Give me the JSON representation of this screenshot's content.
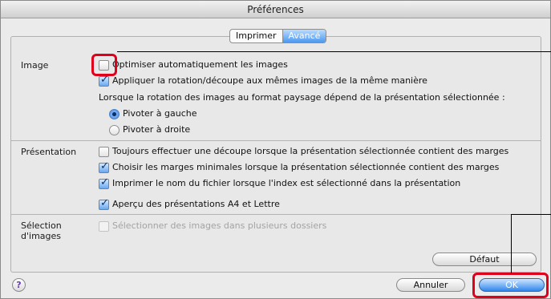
{
  "window": {
    "title": "Préférences"
  },
  "tabs": [
    {
      "label": "Imprimer",
      "active": false
    },
    {
      "label": "Avancé",
      "active": true
    }
  ],
  "sections": {
    "image": {
      "label": "Image",
      "optimize": {
        "label": "Optimiser automatiquement les images",
        "checked": false
      },
      "rotation": {
        "label": "Appliquer la rotation/découpe aux mêmes images de la même manière",
        "checked": true
      },
      "note": "Lorsque la rotation des images au format paysage dépend de la présentation sélectionnée :",
      "rotate_left": {
        "label": "Pivoter à gauche",
        "selected": true
      },
      "rotate_right": {
        "label": "Pivoter à droite",
        "selected": false
      }
    },
    "presentation": {
      "label": "Présentation",
      "crop": {
        "label": "Toujours effectuer une découpe lorsque la présentation sélectionnée contient des marges",
        "checked": false
      },
      "margins": {
        "label": "Choisir les marges minimales lorsque la présentation sélectionnée contient des marges",
        "checked": true
      },
      "filename": {
        "label": "Imprimer le nom du fichier lorsque l'index est sélectionné dans la présentation",
        "checked": true
      },
      "preview": {
        "label": "Aperçu des présentations A4 et Lettre",
        "checked": true
      }
    },
    "selection": {
      "label_line1": "Sélection",
      "label_line2": "d'images",
      "multi_folders": {
        "label": "Sélectionner des images dans plusieurs dossiers",
        "checked": false,
        "disabled": true
      }
    }
  },
  "buttons": {
    "default": "Défaut",
    "cancel": "Annuler",
    "ok": "OK",
    "help": "?"
  },
  "colors": {
    "accent": "#3f86e3",
    "highlight": "#e0001b"
  }
}
